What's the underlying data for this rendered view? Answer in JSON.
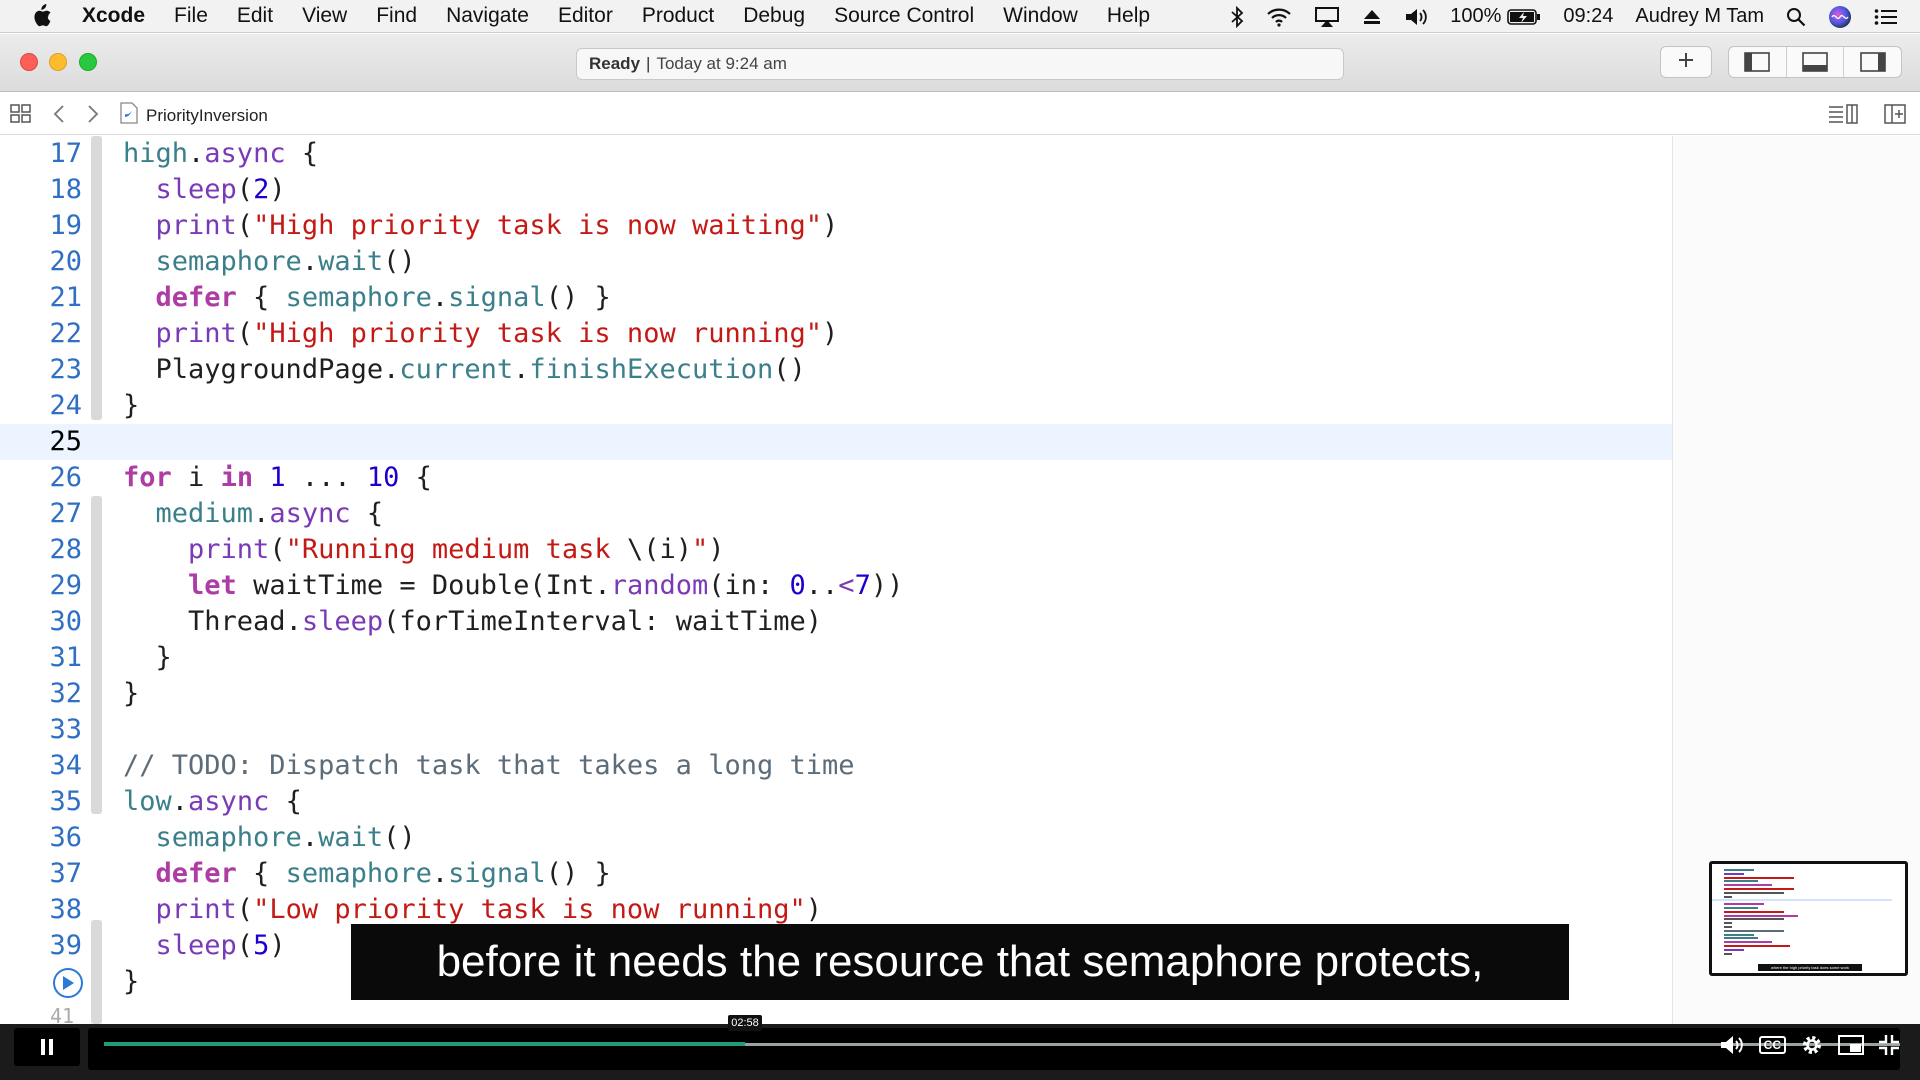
{
  "menubar": {
    "app_name": "Xcode",
    "items": [
      "File",
      "Edit",
      "View",
      "Find",
      "Navigate",
      "Editor",
      "Product",
      "Debug",
      "Source Control",
      "Window",
      "Help"
    ],
    "battery": "100%",
    "clock": "09:24",
    "user": "Audrey M Tam",
    "icons": [
      "apple-icon",
      "bluetooth-icon",
      "wifi-icon",
      "airplay-icon",
      "eject-icon",
      "volume-icon",
      "battery-icon",
      "search-icon",
      "siri-icon",
      "list-icon"
    ]
  },
  "toolbar": {
    "status_state": "Ready",
    "status_separator": "|",
    "status_time": "Today at 9:24 am"
  },
  "jumpbar": {
    "file_name": "PriorityInversion"
  },
  "editor": {
    "current_line": 25,
    "lines": [
      {
        "n": "17",
        "indent": "",
        "tokens": [
          [
            "id",
            "high"
          ],
          [
            "plain",
            "."
          ],
          [
            "fn",
            "async"
          ],
          [
            "plain",
            " {"
          ]
        ]
      },
      {
        "n": "18",
        "indent": "  ",
        "tokens": [
          [
            "fn",
            "sleep"
          ],
          [
            "plain",
            "("
          ],
          [
            "num",
            "2"
          ],
          [
            "plain",
            ")"
          ]
        ]
      },
      {
        "n": "19",
        "indent": "  ",
        "tokens": [
          [
            "fn",
            "print"
          ],
          [
            "plain",
            "("
          ],
          [
            "str",
            "\"High priority task is now waiting\""
          ],
          [
            "plain",
            ")"
          ]
        ]
      },
      {
        "n": "20",
        "indent": "  ",
        "tokens": [
          [
            "id",
            "semaphore"
          ],
          [
            "plain",
            "."
          ],
          [
            "id",
            "wait"
          ],
          [
            "plain",
            "()"
          ]
        ]
      },
      {
        "n": "21",
        "indent": "  ",
        "tokens": [
          [
            "kw",
            "defer"
          ],
          [
            "plain",
            " { "
          ],
          [
            "id",
            "semaphore"
          ],
          [
            "plain",
            "."
          ],
          [
            "id",
            "signal"
          ],
          [
            "plain",
            "() }"
          ]
        ]
      },
      {
        "n": "22",
        "indent": "  ",
        "tokens": [
          [
            "fn",
            "print"
          ],
          [
            "plain",
            "("
          ],
          [
            "str",
            "\"High priority task is now running\""
          ],
          [
            "plain",
            ")"
          ]
        ]
      },
      {
        "n": "23",
        "indent": "  ",
        "tokens": [
          [
            "plain",
            "PlaygroundPage."
          ],
          [
            "id",
            "current"
          ],
          [
            "plain",
            "."
          ],
          [
            "id",
            "finishExecution"
          ],
          [
            "plain",
            "()"
          ]
        ]
      },
      {
        "n": "24",
        "indent": "",
        "tokens": [
          [
            "plain",
            "}"
          ]
        ]
      },
      {
        "n": "25",
        "indent": "",
        "tokens": []
      },
      {
        "n": "26",
        "indent": "",
        "tokens": [
          [
            "kw",
            "for"
          ],
          [
            "plain",
            " i "
          ],
          [
            "kw",
            "in"
          ],
          [
            "plain",
            " "
          ],
          [
            "num",
            "1"
          ],
          [
            "plain",
            " ... "
          ],
          [
            "num",
            "10"
          ],
          [
            "plain",
            " {"
          ]
        ]
      },
      {
        "n": "27",
        "indent": "  ",
        "tokens": [
          [
            "id",
            "medium"
          ],
          [
            "plain",
            "."
          ],
          [
            "fn",
            "async"
          ],
          [
            "plain",
            " {"
          ]
        ]
      },
      {
        "n": "28",
        "indent": "    ",
        "tokens": [
          [
            "fn",
            "print"
          ],
          [
            "plain",
            "("
          ],
          [
            "str",
            "\"Running medium task "
          ],
          [
            "plain",
            "\\(i)"
          ],
          [
            "str",
            "\""
          ],
          [
            "plain",
            ")"
          ]
        ]
      },
      {
        "n": "29",
        "indent": "    ",
        "tokens": [
          [
            "kw",
            "let"
          ],
          [
            "plain",
            " waitTime = Double(Int."
          ],
          [
            "fn",
            "random"
          ],
          [
            "plain",
            "(in: "
          ],
          [
            "num",
            "0"
          ],
          [
            "plain",
            ".."
          ],
          [
            "fn",
            "<"
          ],
          [
            "num",
            "7"
          ],
          [
            "plain",
            "))"
          ]
        ]
      },
      {
        "n": "30",
        "indent": "    ",
        "tokens": [
          [
            "plain",
            "Thread."
          ],
          [
            "fn",
            "sleep"
          ],
          [
            "plain",
            "(forTimeInterval: waitTime)"
          ]
        ]
      },
      {
        "n": "31",
        "indent": "  ",
        "tokens": [
          [
            "plain",
            "}"
          ]
        ]
      },
      {
        "n": "32",
        "indent": "",
        "tokens": [
          [
            "plain",
            "}"
          ]
        ]
      },
      {
        "n": "33",
        "indent": "",
        "tokens": []
      },
      {
        "n": "34",
        "indent": "",
        "tokens": [
          [
            "com",
            "// TODO: Dispatch task that takes a long time"
          ]
        ]
      },
      {
        "n": "35",
        "indent": "",
        "tokens": [
          [
            "id",
            "low"
          ],
          [
            "plain",
            "."
          ],
          [
            "fn",
            "async"
          ],
          [
            "plain",
            " {"
          ]
        ]
      },
      {
        "n": "36",
        "indent": "  ",
        "tokens": [
          [
            "id",
            "semaphore"
          ],
          [
            "plain",
            "."
          ],
          [
            "id",
            "wait"
          ],
          [
            "plain",
            "()"
          ]
        ]
      },
      {
        "n": "37",
        "indent": "  ",
        "tokens": [
          [
            "kw",
            "defer"
          ],
          [
            "plain",
            " { "
          ],
          [
            "id",
            "semaphore"
          ],
          [
            "plain",
            "."
          ],
          [
            "id",
            "signal"
          ],
          [
            "plain",
            "() }"
          ]
        ]
      },
      {
        "n": "38",
        "indent": "  ",
        "tokens": [
          [
            "fn",
            "print"
          ],
          [
            "plain",
            "("
          ],
          [
            "str",
            "\"Low priority task is now running\""
          ],
          [
            "plain",
            ")"
          ]
        ]
      },
      {
        "n": "39",
        "indent": "  ",
        "tokens": [
          [
            "fn",
            "sleep"
          ],
          [
            "plain",
            "("
          ],
          [
            "num",
            "5"
          ],
          [
            "plain",
            ")"
          ]
        ]
      },
      {
        "n": "",
        "indent": "",
        "tokens": [
          [
            "plain",
            "}"
          ]
        ]
      }
    ],
    "partial_line_number": "41"
  },
  "subtitle": {
    "text": "before it needs the resource that semaphore protects,"
  },
  "pip": {
    "caption": "where the high priority task does some work"
  },
  "player": {
    "time_tooltip": "02:58",
    "progress_fraction": 0.357,
    "accent_color": "#1e9c7c",
    "cc_label": "CC"
  }
}
